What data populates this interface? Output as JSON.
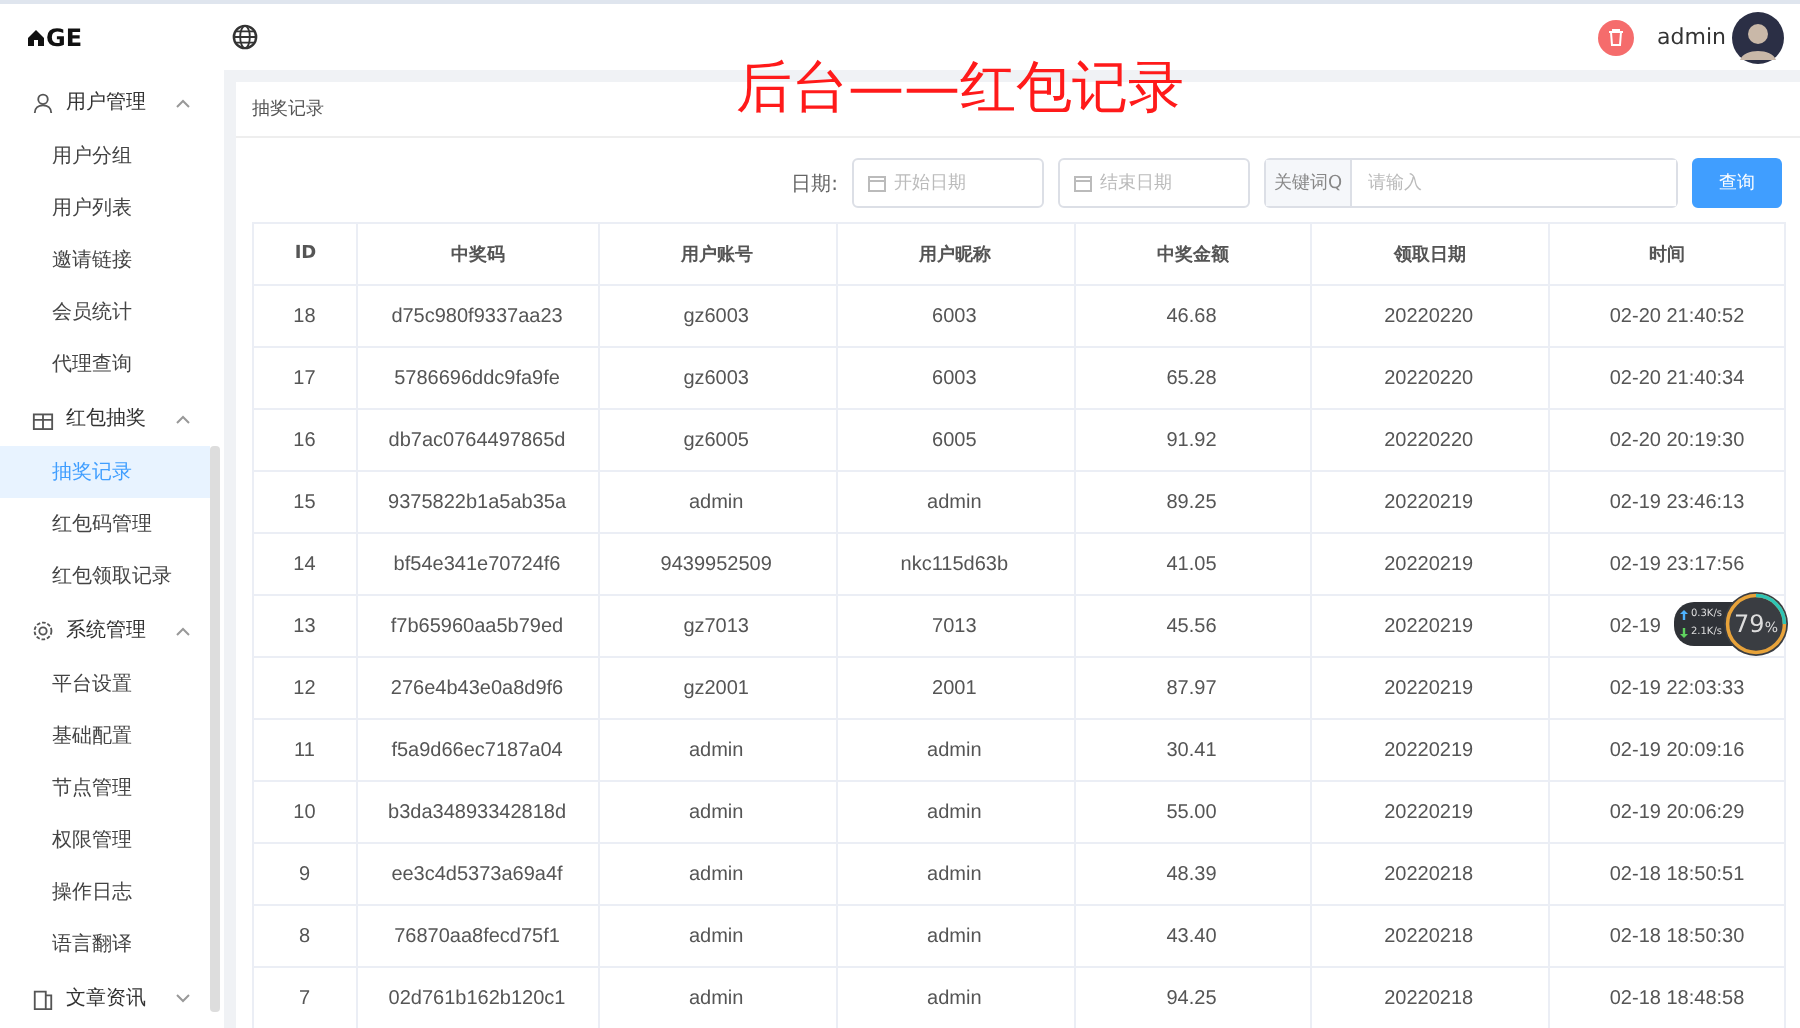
{
  "topbar": {
    "logo": "GE",
    "user": "admin"
  },
  "sidebar": {
    "groups": [
      {
        "label": "用户管理",
        "expanded": true,
        "children": [
          {
            "label": "用户分组",
            "selected": false
          },
          {
            "label": "用户列表",
            "selected": false
          },
          {
            "label": "邀请链接",
            "selected": false
          },
          {
            "label": "会员统计",
            "selected": false
          },
          {
            "label": "代理查询",
            "selected": false
          }
        ]
      },
      {
        "label": "红包抽奖",
        "expanded": true,
        "children": [
          {
            "label": "抽奖记录",
            "selected": true
          },
          {
            "label": "红包码管理",
            "selected": false
          },
          {
            "label": "红包领取记录",
            "selected": false
          }
        ]
      },
      {
        "label": "系统管理",
        "expanded": true,
        "children": [
          {
            "label": "平台设置",
            "selected": false
          },
          {
            "label": "基础配置",
            "selected": false
          },
          {
            "label": "节点管理",
            "selected": false
          },
          {
            "label": "权限管理",
            "selected": false
          },
          {
            "label": "操作日志",
            "selected": false
          },
          {
            "label": "语言翻译",
            "selected": false
          }
        ]
      },
      {
        "label": "文章资讯",
        "expanded": false
      }
    ]
  },
  "breadcrumb": "抽奖记录",
  "annotation": "后台——红包记录",
  "filters": {
    "date_label": "日期:",
    "start_placeholder": "开始日期",
    "end_placeholder": "结束日期",
    "keyword_label": "关键词Q",
    "keyword_placeholder": "请输入",
    "search_button": "查询"
  },
  "table": {
    "columns": [
      "ID",
      "中奖码",
      "用户账号",
      "用户昵称",
      "中奖金额",
      "领取日期",
      "时间"
    ],
    "rows": [
      [
        "18",
        "d75c980f9337aa23",
        "gz6003",
        "6003",
        "46.68",
        "20220220",
        "02-20 21:40:52"
      ],
      [
        "17",
        "5786696ddc9fa9fe",
        "gz6003",
        "6003",
        "65.28",
        "20220220",
        "02-20 21:40:34"
      ],
      [
        "16",
        "db7ac0764497865d",
        "gz6005",
        "6005",
        "91.92",
        "20220220",
        "02-20 20:19:30"
      ],
      [
        "15",
        "9375822b1a5ab35a",
        "admin",
        "admin",
        "89.25",
        "20220219",
        "02-19 23:46:13"
      ],
      [
        "14",
        "bf54e341e70724f6",
        "9439952509",
        "nkc115d63b",
        "41.05",
        "20220219",
        "02-19 23:17:56"
      ],
      [
        "13",
        "f7b65960aa5b79ed",
        "gz7013",
        "7013",
        "45.56",
        "20220219",
        "02-19"
      ],
      [
        "12",
        "276e4b43e0a8d9f6",
        "gz2001",
        "2001",
        "87.97",
        "20220219",
        "02-19 22:03:33"
      ],
      [
        "11",
        "f5a9d66ec7187a04",
        "admin",
        "admin",
        "30.41",
        "20220219",
        "02-19 20:09:16"
      ],
      [
        "10",
        "b3da34893342818d",
        "admin",
        "admin",
        "55.00",
        "20220219",
        "02-19 20:06:29"
      ],
      [
        "9",
        "ee3c4d5373a69a4f",
        "admin",
        "admin",
        "48.39",
        "20220218",
        "02-18 18:50:51"
      ],
      [
        "8",
        "76870aa8fecd75f1",
        "admin",
        "admin",
        "43.40",
        "20220218",
        "02-18 18:50:30"
      ],
      [
        "7",
        "02d761b162b120c1",
        "admin",
        "admin",
        "94.25",
        "20220218",
        "02-18 18:48:58"
      ]
    ]
  },
  "speed_widget": {
    "up": "0.3",
    "up_unit": "K/s",
    "down": "2.1",
    "down_unit": "K/s",
    "percent": "79",
    "percent_unit": "%"
  }
}
